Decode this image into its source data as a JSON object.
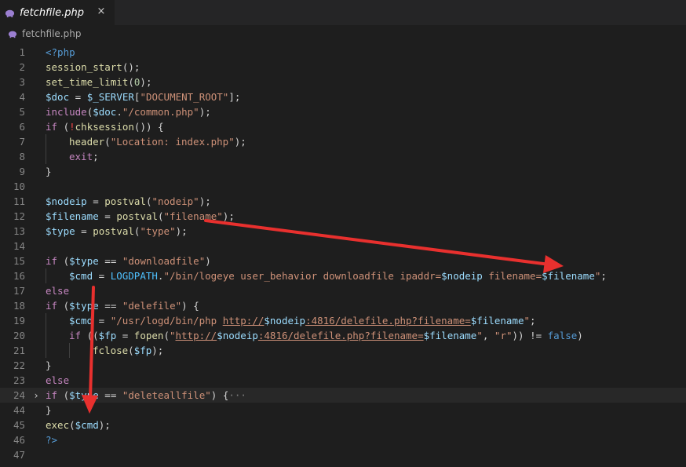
{
  "tab": {
    "title": "fetchfile.php",
    "close_glyph": "×"
  },
  "breadcrumb": {
    "label": "fetchfile.php"
  },
  "editor": {
    "lines": [
      {
        "n": "1",
        "indent": 0,
        "tokens": [
          [
            "tag",
            "<?php"
          ]
        ]
      },
      {
        "n": "2",
        "indent": 0,
        "tokens": [
          [
            "fn",
            "session_start"
          ],
          [
            "pun",
            "();"
          ]
        ]
      },
      {
        "n": "3",
        "indent": 0,
        "tokens": [
          [
            "fn",
            "set_time_limit"
          ],
          [
            "pun",
            "("
          ],
          [
            "num",
            "0"
          ],
          [
            "pun",
            ");"
          ]
        ]
      },
      {
        "n": "4",
        "indent": 0,
        "tokens": [
          [
            "var",
            "$doc"
          ],
          [
            "pun",
            " = "
          ],
          [
            "var",
            "$_SERVER"
          ],
          [
            "pun",
            "["
          ],
          [
            "str",
            "\"DOCUMENT_ROOT\""
          ],
          [
            "pun",
            "];"
          ]
        ]
      },
      {
        "n": "5",
        "indent": 0,
        "tokens": [
          [
            "kw",
            "include"
          ],
          [
            "pun",
            "("
          ],
          [
            "var",
            "$doc"
          ],
          [
            "pun",
            "."
          ],
          [
            "str",
            "\"/common.php\""
          ],
          [
            "pun",
            ");"
          ]
        ]
      },
      {
        "n": "6",
        "indent": 0,
        "tokens": [
          [
            "kw",
            "if"
          ],
          [
            "pun",
            " ("
          ],
          [
            "red",
            "!"
          ],
          [
            "fn",
            "chksession"
          ],
          [
            "pun",
            "()) {"
          ]
        ]
      },
      {
        "n": "7",
        "indent": 1,
        "tokens": [
          [
            "fn",
            "header"
          ],
          [
            "pun",
            "("
          ],
          [
            "str",
            "\"Location: index.php\""
          ],
          [
            "pun",
            ");"
          ]
        ]
      },
      {
        "n": "8",
        "indent": 1,
        "tokens": [
          [
            "kw",
            "exit"
          ],
          [
            "pun",
            ";"
          ]
        ]
      },
      {
        "n": "9",
        "indent": 0,
        "tokens": [
          [
            "pun",
            "}"
          ]
        ]
      },
      {
        "n": "10",
        "indent": 0,
        "tokens": []
      },
      {
        "n": "11",
        "indent": 0,
        "tokens": [
          [
            "var",
            "$nodeip"
          ],
          [
            "pun",
            " = "
          ],
          [
            "fn",
            "postval"
          ],
          [
            "pun",
            "("
          ],
          [
            "str",
            "\"nodeip\""
          ],
          [
            "pun",
            ");"
          ]
        ]
      },
      {
        "n": "12",
        "indent": 0,
        "tokens": [
          [
            "var",
            "$filename"
          ],
          [
            "pun",
            " = "
          ],
          [
            "fn",
            "postval"
          ],
          [
            "pun",
            "("
          ],
          [
            "str",
            "\"filename\""
          ],
          [
            "pun",
            ");"
          ]
        ]
      },
      {
        "n": "13",
        "indent": 0,
        "tokens": [
          [
            "var",
            "$type"
          ],
          [
            "pun",
            " = "
          ],
          [
            "fn",
            "postval"
          ],
          [
            "pun",
            "("
          ],
          [
            "str",
            "\"type\""
          ],
          [
            "pun",
            ");"
          ]
        ]
      },
      {
        "n": "14",
        "indent": 0,
        "tokens": []
      },
      {
        "n": "15",
        "indent": 0,
        "tokens": [
          [
            "kw",
            "if"
          ],
          [
            "pun",
            " ("
          ],
          [
            "var",
            "$type"
          ],
          [
            "pun",
            " == "
          ],
          [
            "str",
            "\"downloadfile\""
          ],
          [
            "pun",
            ")"
          ]
        ]
      },
      {
        "n": "16",
        "indent": 1,
        "tokens": [
          [
            "var",
            "$cmd"
          ],
          [
            "pun",
            " = "
          ],
          [
            "const",
            "LOGDPATH"
          ],
          [
            "pun",
            "."
          ],
          [
            "str",
            "\"/bin/logeye user_behavior downloadfile ipaddr="
          ],
          [
            "var",
            "$nodeip"
          ],
          [
            "str",
            " filename="
          ],
          [
            "var",
            "$filename"
          ],
          [
            "str",
            "\""
          ],
          [
            "pun",
            ";"
          ]
        ]
      },
      {
        "n": "17",
        "indent": 0,
        "tokens": [
          [
            "kw",
            "else"
          ]
        ]
      },
      {
        "n": "18",
        "indent": 0,
        "tokens": [
          [
            "kw",
            "if"
          ],
          [
            "pun",
            " ("
          ],
          [
            "var",
            "$type"
          ],
          [
            "pun",
            " == "
          ],
          [
            "str",
            "\"delefile\""
          ],
          [
            "pun",
            ") {"
          ]
        ]
      },
      {
        "n": "19",
        "indent": 1,
        "tokens": [
          [
            "var",
            "$cmd"
          ],
          [
            "pun",
            " = "
          ],
          [
            "str",
            "\"/usr/logd/bin/php "
          ],
          [
            "url",
            "http://"
          ],
          [
            "var",
            "$nodeip"
          ],
          [
            "url",
            ":4816/delefile.php?filename="
          ],
          [
            "var",
            "$filename"
          ],
          [
            "str",
            "\""
          ],
          [
            "pun",
            ";"
          ]
        ]
      },
      {
        "n": "20",
        "indent": 1,
        "tokens": [
          [
            "kw",
            "if"
          ],
          [
            "pun",
            " (("
          ],
          [
            "var",
            "$fp"
          ],
          [
            "pun",
            " = "
          ],
          [
            "fn",
            "fopen"
          ],
          [
            "pun",
            "("
          ],
          [
            "str",
            "\""
          ],
          [
            "url",
            "http://"
          ],
          [
            "var",
            "$nodeip"
          ],
          [
            "url",
            ":4816/delefile.php?filename="
          ],
          [
            "var",
            "$filename"
          ],
          [
            "str",
            "\""
          ],
          [
            "pun",
            ", "
          ],
          [
            "str",
            "\"r\""
          ],
          [
            "pun",
            ")) != "
          ],
          [
            "bool",
            "false"
          ],
          [
            "pun",
            ")"
          ]
        ]
      },
      {
        "n": "21",
        "indent": 2,
        "tokens": [
          [
            "fn",
            "fclose"
          ],
          [
            "pun",
            "("
          ],
          [
            "var",
            "$fp"
          ],
          [
            "pun",
            ");"
          ]
        ]
      },
      {
        "n": "22",
        "indent": 0,
        "tokens": [
          [
            "pun",
            "}"
          ]
        ]
      },
      {
        "n": "23",
        "indent": 0,
        "tokens": [
          [
            "kw",
            "else"
          ]
        ]
      },
      {
        "n": "24",
        "indent": 0,
        "active": true,
        "folded": true,
        "tokens": [
          [
            "kw",
            "if"
          ],
          [
            "pun",
            " ("
          ],
          [
            "var",
            "$type"
          ],
          [
            "pun",
            " == "
          ],
          [
            "str",
            "\"deleteallfile\""
          ],
          [
            "pun",
            ") {"
          ],
          [
            "dim",
            "···"
          ]
        ]
      },
      {
        "n": "44",
        "indent": 0,
        "tokens": [
          [
            "pun",
            "}"
          ]
        ]
      },
      {
        "n": "45",
        "indent": 0,
        "tokens": [
          [
            "fn",
            "exec"
          ],
          [
            "pun",
            "("
          ],
          [
            "var",
            "$cmd"
          ],
          [
            "pun",
            ");"
          ]
        ]
      },
      {
        "n": "46",
        "indent": 0,
        "tokens": [
          [
            "tag",
            "?>"
          ]
        ]
      },
      {
        "n": "47",
        "indent": 0,
        "tokens": []
      }
    ],
    "fold_glyph": "›"
  },
  "colors": {
    "annotation_arrow": "#e8302e",
    "background": "#1e1e1e",
    "php_icon": "#9b7fd1"
  },
  "icons": {
    "tab_file": "php-elephant-icon",
    "breadcrumb_file": "php-elephant-icon"
  }
}
